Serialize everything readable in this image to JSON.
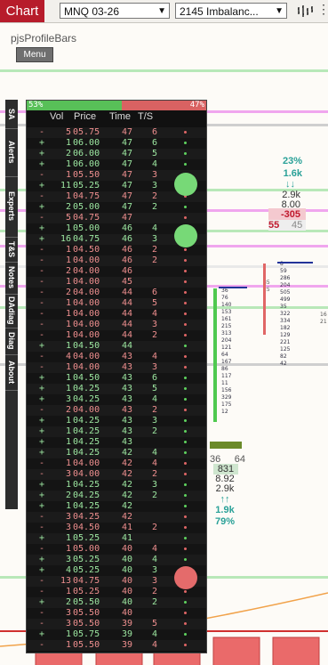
{
  "toolbar": {
    "chart_label": "Chart",
    "instrument": "MNQ 03-26",
    "template": "2145 Imbalanc...",
    "bars_icon": "bar-chart-icon",
    "more_icon": "more-icon"
  },
  "indicator": {
    "name": "pjsProfileBars",
    "menu_label": "Menu"
  },
  "side_tabs": [
    "SA",
    "Alerts",
    "Experts",
    "T&S",
    "Notes",
    "DAdiag",
    "Diag",
    "About"
  ],
  "tas": {
    "buy_pct": "53%",
    "sell_pct": "47%",
    "columns": [
      "Vol",
      "Price",
      "Time",
      "T/S"
    ],
    "rows": [
      {
        "side": "-",
        "vol": "5",
        "price": "05.75",
        "time": "47",
        "ts": "6"
      },
      {
        "side": "+",
        "vol": "1",
        "price": "06.00",
        "time": "47",
        "ts": "6"
      },
      {
        "side": "+",
        "vol": "2",
        "price": "06.00",
        "time": "47",
        "ts": "5"
      },
      {
        "side": "+",
        "vol": "1",
        "price": "06.00",
        "time": "47",
        "ts": "4"
      },
      {
        "side": "-",
        "vol": "1",
        "price": "05.50",
        "time": "47",
        "ts": "3"
      },
      {
        "side": "+",
        "vol": "11",
        "price": "05.25",
        "time": "47",
        "ts": "3"
      },
      {
        "side": "-",
        "vol": "1",
        "price": "04.75",
        "time": "47",
        "ts": "2"
      },
      {
        "side": "+",
        "vol": "2",
        "price": "05.00",
        "time": "47",
        "ts": "2"
      },
      {
        "side": "-",
        "vol": "5",
        "price": "04.75",
        "time": "47",
        "ts": ""
      },
      {
        "side": "+",
        "vol": "1",
        "price": "05.00",
        "time": "46",
        "ts": "4"
      },
      {
        "side": "+",
        "vol": "16",
        "price": "04.75",
        "time": "46",
        "ts": "3"
      },
      {
        "side": "-",
        "vol": "1",
        "price": "04.50",
        "time": "46",
        "ts": "2"
      },
      {
        "side": "-",
        "vol": "1",
        "price": "04.00",
        "time": "46",
        "ts": "2"
      },
      {
        "side": "-",
        "vol": "2",
        "price": "04.00",
        "time": "46",
        "ts": ""
      },
      {
        "side": "-",
        "vol": "1",
        "price": "04.00",
        "time": "45",
        "ts": ""
      },
      {
        "side": "-",
        "vol": "2",
        "price": "04.00",
        "time": "44",
        "ts": "6"
      },
      {
        "side": "-",
        "vol": "1",
        "price": "04.00",
        "time": "44",
        "ts": "5"
      },
      {
        "side": "-",
        "vol": "1",
        "price": "04.00",
        "time": "44",
        "ts": "4"
      },
      {
        "side": "-",
        "vol": "1",
        "price": "04.00",
        "time": "44",
        "ts": "3"
      },
      {
        "side": "-",
        "vol": "1",
        "price": "04.00",
        "time": "44",
        "ts": "2"
      },
      {
        "side": "+",
        "vol": "1",
        "price": "04.50",
        "time": "44",
        "ts": ""
      },
      {
        "side": "-",
        "vol": "4",
        "price": "04.00",
        "time": "43",
        "ts": "4"
      },
      {
        "side": "-",
        "vol": "1",
        "price": "04.00",
        "time": "43",
        "ts": "3"
      },
      {
        "side": "+",
        "vol": "1",
        "price": "04.50",
        "time": "43",
        "ts": "6"
      },
      {
        "side": "+",
        "vol": "1",
        "price": "04.25",
        "time": "43",
        "ts": "5"
      },
      {
        "side": "+",
        "vol": "3",
        "price": "04.25",
        "time": "43",
        "ts": "4"
      },
      {
        "side": "-",
        "vol": "2",
        "price": "04.00",
        "time": "43",
        "ts": "2"
      },
      {
        "side": "+",
        "vol": "1",
        "price": "04.25",
        "time": "43",
        "ts": "3"
      },
      {
        "side": "+",
        "vol": "1",
        "price": "04.25",
        "time": "43",
        "ts": "2"
      },
      {
        "side": "+",
        "vol": "1",
        "price": "04.25",
        "time": "43",
        "ts": ""
      },
      {
        "side": "+",
        "vol": "1",
        "price": "04.25",
        "time": "42",
        "ts": "4"
      },
      {
        "side": "-",
        "vol": "1",
        "price": "04.00",
        "time": "42",
        "ts": "4"
      },
      {
        "side": "-",
        "vol": "3",
        "price": "04.00",
        "time": "42",
        "ts": "2"
      },
      {
        "side": "+",
        "vol": "1",
        "price": "04.25",
        "time": "42",
        "ts": "3"
      },
      {
        "side": "+",
        "vol": "2",
        "price": "04.25",
        "time": "42",
        "ts": "2"
      },
      {
        "side": "+",
        "vol": "1",
        "price": "04.25",
        "time": "42",
        "ts": ""
      },
      {
        "side": "-",
        "vol": "3",
        "price": "04.25",
        "time": "42",
        "ts": ""
      },
      {
        "side": "-",
        "vol": "3",
        "price": "04.50",
        "time": "41",
        "ts": "2"
      },
      {
        "side": "+",
        "vol": "1",
        "price": "05.25",
        "time": "41",
        "ts": ""
      },
      {
        "side": "-",
        "vol": "1",
        "price": "05.00",
        "time": "40",
        "ts": "4"
      },
      {
        "side": "+",
        "vol": "3",
        "price": "05.25",
        "time": "40",
        "ts": "4"
      },
      {
        "side": "+",
        "vol": "4",
        "price": "05.25",
        "time": "40",
        "ts": "3"
      },
      {
        "side": "-",
        "vol": "13",
        "price": "04.75",
        "time": "40",
        "ts": "3"
      },
      {
        "side": "-",
        "vol": "1",
        "price": "05.25",
        "time": "40",
        "ts": "2"
      },
      {
        "side": "+",
        "vol": "2",
        "price": "05.50",
        "time": "40",
        "ts": "2"
      },
      {
        "side": "-",
        "vol": "3",
        "price": "05.50",
        "time": "40",
        "ts": ""
      },
      {
        "side": "-",
        "vol": "3",
        "price": "05.50",
        "time": "39",
        "ts": "5"
      },
      {
        "side": "+",
        "vol": "1",
        "price": "05.75",
        "time": "39",
        "ts": "4"
      },
      {
        "side": "-",
        "vol": "1",
        "price": "05.50",
        "time": "39",
        "ts": "4"
      }
    ]
  },
  "bar_stats_upper": {
    "delta_pct": "23%",
    "volume": "1.6k",
    "arrows": "↓↓",
    "sell_vol": "2.9k",
    "ratio": "8.00",
    "delta": "-305",
    "bid": "55",
    "ask": "45"
  },
  "bar_stats_lower": {
    "left": "36",
    "right": "64",
    "total": "831",
    "ratio": "8.92",
    "volume": "2.9k",
    "arrows": "↑↑",
    "buy_vol": "1.9k",
    "pct": "79%"
  },
  "profile_upper": [
    "8",
    "59",
    "286",
    "204",
    "505",
    "499",
    "35",
    "322",
    "334",
    "182",
    "129",
    "221",
    "125",
    "82",
    "42"
  ],
  "profile_upper_left": [
    "85",
    "25"
  ],
  "profile_lower": [
    "36",
    "76",
    "140",
    "153",
    "161",
    "215",
    "313",
    "204",
    "121",
    "64",
    "167",
    "86",
    "117",
    "11",
    "156",
    "329",
    "175",
    "12"
  ],
  "profile_right": [
    "16",
    "21"
  ],
  "colors": {
    "buy": "#5fd35f",
    "sell": "#e06666",
    "accent": "#b71c2b",
    "bubble_green": "#77d977",
    "bubble_red": "#e46b6b"
  }
}
